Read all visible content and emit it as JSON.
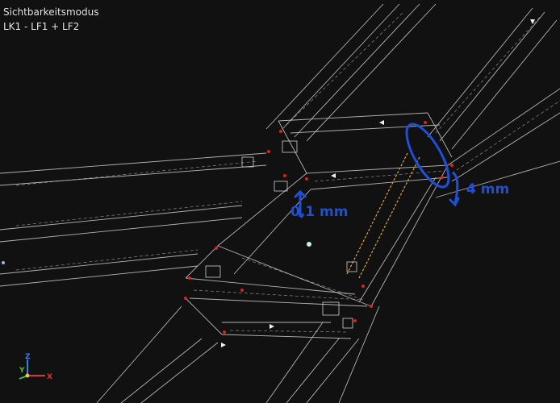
{
  "app": {
    "mode_label": "Sichtbarkeitsmodus",
    "load_case": "LK1 - LF1 + LF2"
  },
  "annotations": {
    "left_dimension": "0,1 mm",
    "right_dimension": "4 mm",
    "ink_color": "#1f4fd8"
  },
  "axes": {
    "x": "X",
    "y": "Y",
    "z": "Z"
  },
  "colors": {
    "background": "#111111",
    "edge": "#cfcfcf",
    "node": "#e02020",
    "accent_member": "#d9a54a"
  }
}
